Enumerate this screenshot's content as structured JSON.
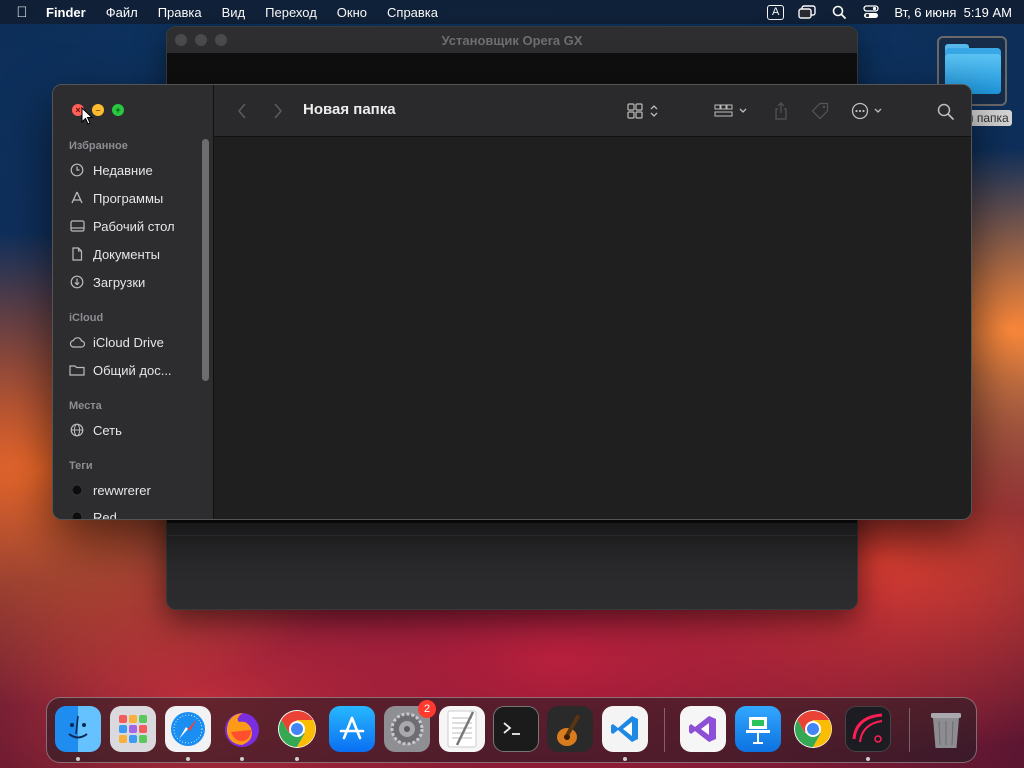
{
  "menubar": {
    "app_name": "Finder",
    "items": [
      "Файл",
      "Правка",
      "Вид",
      "Переход",
      "Окно",
      "Справка"
    ],
    "input_source": "A",
    "clock": "Вт, 6 июня  5:19 AM"
  },
  "background_window": {
    "title": "Установщик Opera GX"
  },
  "desktop": {
    "folder_label": "я папка"
  },
  "finder": {
    "path_title": "Новая папка",
    "sidebar": {
      "favorites_header": "Избранное",
      "favorites": [
        {
          "label": "Недавние",
          "icon": "clock-icon"
        },
        {
          "label": "Программы",
          "icon": "apps-icon"
        },
        {
          "label": "Рабочий стол",
          "icon": "desktop-icon"
        },
        {
          "label": "Документы",
          "icon": "document-icon"
        },
        {
          "label": "Загрузки",
          "icon": "download-icon"
        }
      ],
      "icloud_header": "iCloud",
      "icloud": [
        {
          "label": "iCloud Drive",
          "icon": "cloud-icon"
        },
        {
          "label": "Общий дос...",
          "icon": "shared-folder-icon"
        }
      ],
      "locations_header": "Места",
      "locations": [
        {
          "label": "Сеть",
          "icon": "globe-icon"
        }
      ],
      "tags_header": "Теги",
      "tags": [
        {
          "label": "rewwrerer",
          "color": "#111111"
        },
        {
          "label": "Red",
          "color": "#111111"
        }
      ]
    }
  },
  "dock": {
    "settings_badge": "2",
    "apps": [
      "Finder",
      "Launchpad",
      "Safari",
      "Firefox",
      "Chrome",
      "App Store",
      "System Settings",
      "TextEdit",
      "Terminal",
      "GarageBand",
      "VS Code",
      "Visual Studio",
      "Keynote",
      "Chrome",
      "Opera GX",
      "Trash"
    ]
  },
  "colors": {
    "close": "#ff5f57",
    "minimize": "#febc2e",
    "zoom": "#28c840"
  }
}
